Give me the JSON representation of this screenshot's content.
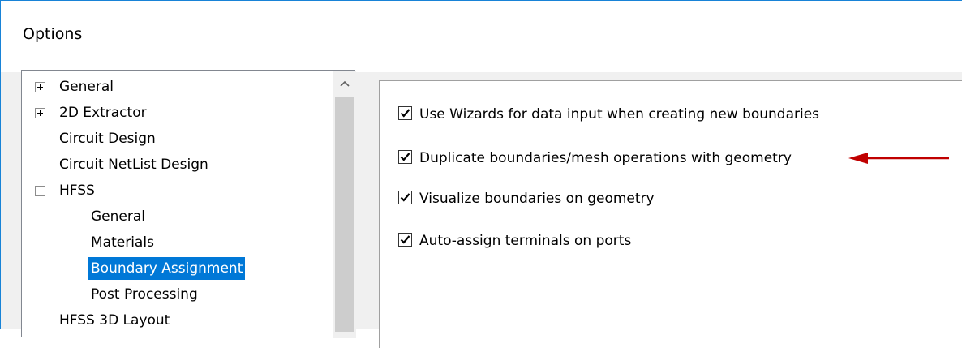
{
  "window": {
    "title": "Options"
  },
  "tree": {
    "items": [
      {
        "label": "General",
        "expander": "plus"
      },
      {
        "label": "2D Extractor",
        "expander": "plus"
      },
      {
        "label": "Circuit Design"
      },
      {
        "label": "Circuit NetList Design"
      },
      {
        "label": "HFSS",
        "expander": "minus"
      },
      {
        "label": "General"
      },
      {
        "label": "Materials"
      },
      {
        "label": "Boundary Assignment",
        "selected": true
      },
      {
        "label": "Post Processing"
      },
      {
        "label": "HFSS 3D Layout"
      }
    ]
  },
  "options": [
    {
      "label": "Use Wizards for data input when creating new boundaries",
      "checked": true
    },
    {
      "label": "Duplicate boundaries/mesh operations with geometry",
      "checked": true
    },
    {
      "label": "Visualize boundaries on geometry",
      "checked": true
    },
    {
      "label": "Auto-assign terminals on ports",
      "checked": true
    }
  ],
  "colors": {
    "selection": "#0078d7",
    "annotation_arrow": "#c00000"
  },
  "icons": {
    "scroll_up": "chevron-up-icon",
    "annotation": "red-arrow-icon"
  }
}
